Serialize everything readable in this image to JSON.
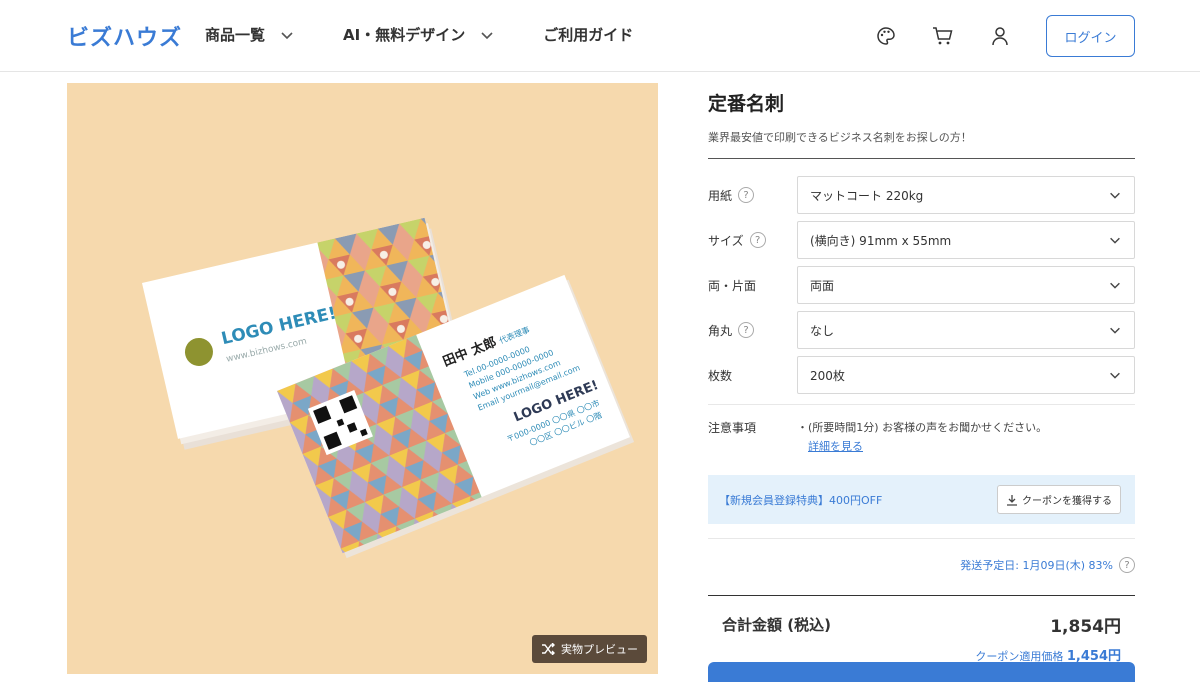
{
  "header": {
    "logo": "ビズハウズ",
    "nav": [
      {
        "label": "商品一覧",
        "dropdown": true
      },
      {
        "label": "AI・無料デザイン",
        "dropdown": true
      },
      {
        "label": "ご利用ガイド",
        "dropdown": false
      }
    ],
    "icons": [
      "palette-icon",
      "cart-icon",
      "user-icon"
    ],
    "login_label": "ログイン"
  },
  "gallery": {
    "preview_label": "実物プレビュー",
    "card": {
      "logo_text": "LOGO HERE!",
      "url": "www.bizhows.com",
      "name": "田中 太郎",
      "role": "代表理事",
      "tel": "Tel.00-0000-0000",
      "mobile": "Mobile 000-0000-0000",
      "web": "Web www.bizhows.com",
      "email": "Email yourmail@email.com",
      "address1": "〒000-0000 〇〇県 〇〇市",
      "address2": "〇〇区 〇〇ビル 〇階"
    }
  },
  "product": {
    "title": "定番名刺",
    "subtitle": "業界最安値で印刷できるビジネス名刺をお探しの方！",
    "options": [
      {
        "label": "用紙",
        "help": true,
        "value": "マットコート 220kg"
      },
      {
        "label": "サイズ",
        "help": true,
        "value": "(横向き) 91mm x 55mm"
      },
      {
        "label": "両・片面",
        "help": false,
        "value": "両面"
      },
      {
        "label": "角丸",
        "help": true,
        "value": "なし"
      },
      {
        "label": "枚数",
        "help": false,
        "value": "200枚"
      }
    ],
    "notes_label": "注意事項",
    "notes_text": "・(所要時間1分) お客様の声をお聞かせください。",
    "notes_link": "詳細を見る",
    "coupon_text": "【新規会員登録特典】400円OFF",
    "coupon_button": "クーポンを獲得する",
    "shipping": "発送予定日: 1月09日(木) 83%",
    "total_label": "合計金額 (税込)",
    "total_value": "1,854円",
    "coupon_price_label": "クーポン適用価格",
    "coupon_price_value": "1,454円"
  },
  "colors": {
    "accent": "#3a7bd5",
    "photo_bg": "#f6d9ad",
    "coupon_bg": "#e4f1fb"
  }
}
